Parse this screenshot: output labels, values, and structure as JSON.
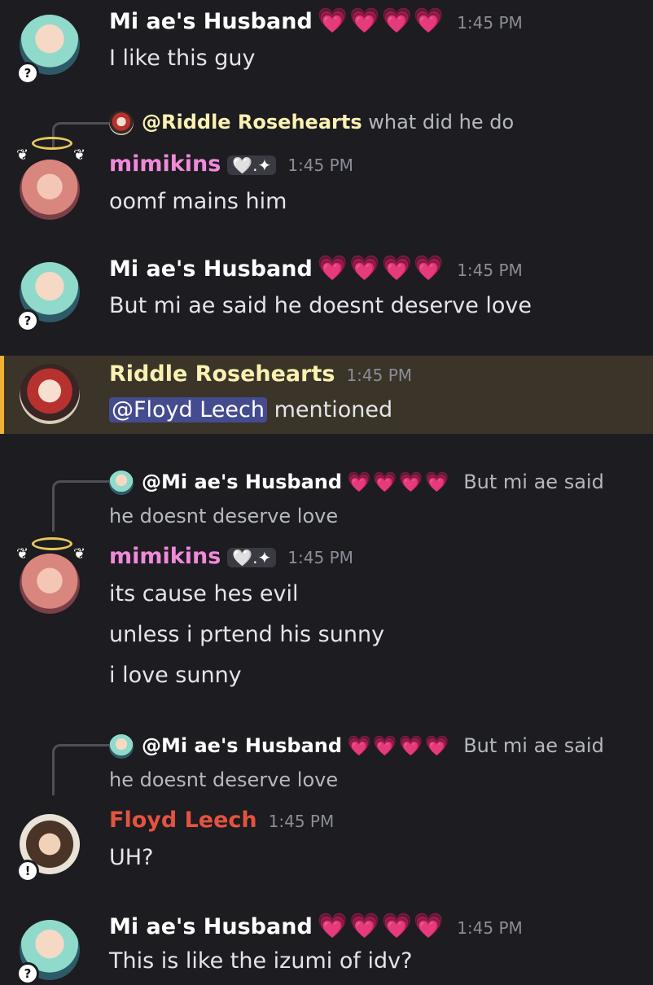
{
  "colors": {
    "background": "#1c1c21",
    "husband_name": "#ffffff",
    "mimikins_name": "#f08ad9",
    "riddle_name": "#fbf1b0",
    "floyd_name": "#e5533f",
    "mention_bg": "#454b8f",
    "highlight_bg": "#3a3429",
    "highlight_border": "#f0b232",
    "hearts": "#ff4fa8"
  },
  "messages": {
    "m1": {
      "author": "Mi ae's Husband",
      "hearts": "💗💗💗💗",
      "time": "1:45 PM",
      "lines": [
        "I like this guy"
      ],
      "badge": "?"
    },
    "m2": {
      "reply_author": "@Riddle Rosehearts",
      "reply_text": "what did he do",
      "author": "mimikins",
      "tag": "🤍.✦",
      "time": "1:45 PM",
      "lines": [
        "oomf mains him"
      ]
    },
    "m3": {
      "author": "Mi ae's Husband",
      "hearts": "💗💗💗💗",
      "time": "1:45 PM",
      "lines": [
        "But mi ae said he doesnt deserve love"
      ],
      "badge": "?"
    },
    "m4": {
      "author": "Riddle Rosehearts",
      "time": "1:45 PM",
      "mention": "@Floyd Leech",
      "after_mention": "mentioned"
    },
    "m5": {
      "reply_author": "@Mi ae's Husband",
      "reply_hearts": "💗💗💗💗",
      "reply_text_1": "But mi ae said",
      "reply_text_2": "he doesnt deserve love",
      "author": "mimikins",
      "tag": "🤍.✦",
      "time": "1:45 PM",
      "lines": [
        "its cause hes evil",
        "unless i prtend his sunny",
        "i love sunny"
      ]
    },
    "m6": {
      "reply_author": "@Mi ae's Husband",
      "reply_hearts": "💗💗💗💗",
      "reply_text_1": "But mi ae said",
      "reply_text_2": "he doesnt deserve love",
      "author": "Floyd Leech",
      "time": "1:45 PM",
      "lines": [
        "UH?"
      ],
      "badge": "!"
    },
    "m7": {
      "author": "Mi ae's Husband",
      "hearts": "💗💗💗💗",
      "time": "1:45 PM",
      "lines": [
        "This is like the izumi of idv?"
      ],
      "badge": "?"
    }
  }
}
